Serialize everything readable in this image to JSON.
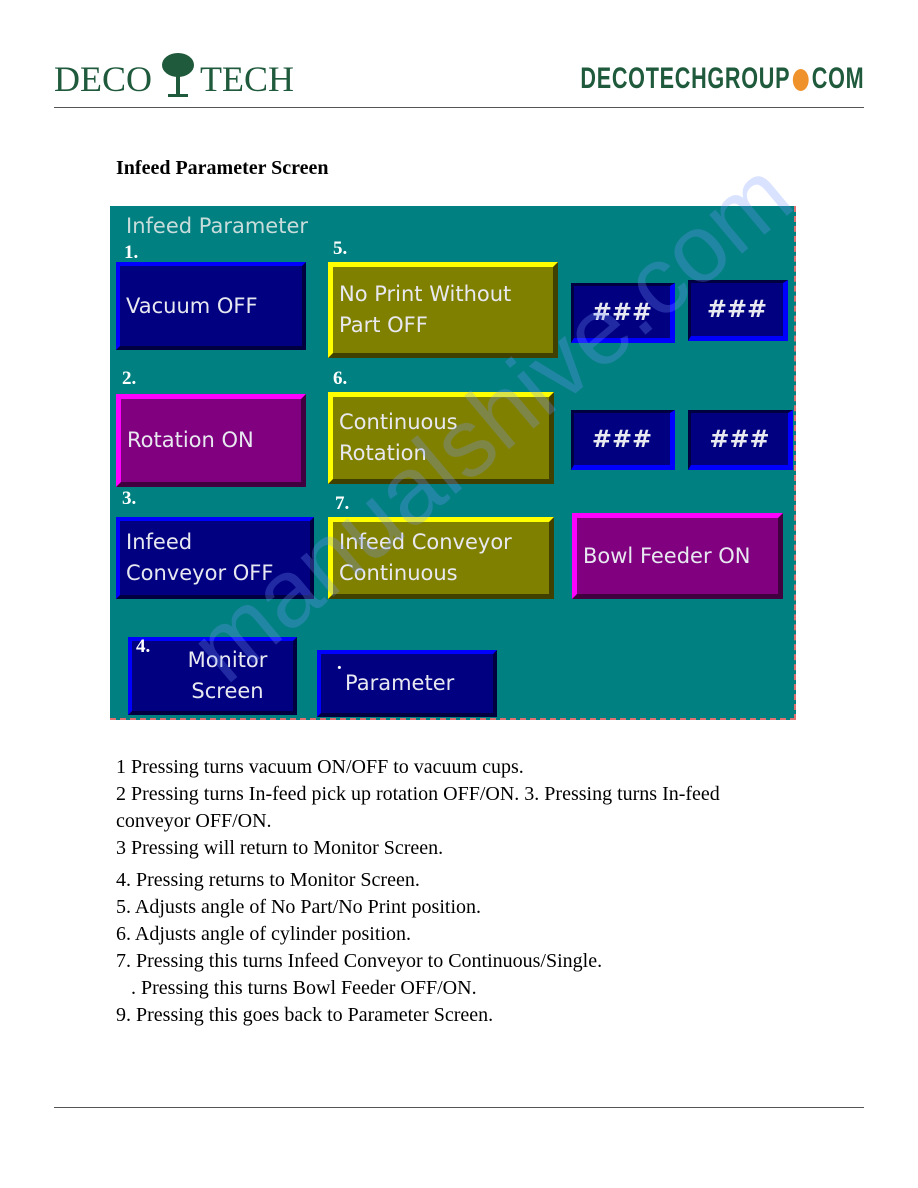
{
  "header": {
    "logo_left": "DECO TECH",
    "logo_left_parts": [
      "DECO",
      "TECH"
    ],
    "logo_right_parts": [
      "DECOTECHGROUP",
      "COM"
    ],
    "accent_dot_color": "#f0922b",
    "brand_color": "#1f5a3c"
  },
  "heading": "Infeed Parameter Screen",
  "screen": {
    "title": "Infeed Parameter",
    "bg_color": "#008080",
    "labels": [
      "1.",
      "2.",
      "3.",
      "4.",
      "5.",
      "6.",
      "7.",
      "."
    ],
    "buttons": {
      "vacuum": "Vacuum OFF",
      "no_print_1": "No Print Without",
      "no_print_2": "Part  OFF",
      "rotation": "Rotation ON",
      "continuous_1": "Continuous",
      "continuous_2": "Rotation",
      "infeed_1": "Infeed",
      "infeed_2": "Conveyor OFF",
      "infeed_cont_1": "Infeed Conveyor",
      "infeed_cont_2": "Continuous",
      "bowl": "Bowl Feeder ON",
      "monitor_1": "Monitor",
      "monitor_2": "Screen",
      "parameter": "Parameter"
    },
    "values": [
      "###",
      "###",
      "###",
      "###"
    ]
  },
  "descriptions": [
    "1  Pressing turns vacuum ON/OFF to vacuum cups.",
    "2  Pressing turns In-feed pick up rotation OFF/ON. 3. Pressing turns In-feed",
    "conveyor OFF/ON.",
    "3  Pressing will return to Monitor Screen.",
    "4. Pressing returns to Monitor Screen.",
    "5. Adjusts angle of No Part/No Print position.",
    "6. Adjusts angle of cylinder position.",
    "7. Pressing this turns Infeed Conveyor to Continuous/Single.",
    "   . Pressing this turns Bowl Feeder OFF/ON.",
    "9. Pressing this goes back to Parameter Screen."
  ],
  "watermark": "manualshive.com"
}
